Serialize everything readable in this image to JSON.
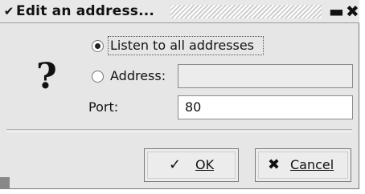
{
  "window": {
    "title": "Edit an address...",
    "menu_icon": "chevron-down-icon",
    "minimize_icon": "minimize-icon",
    "close_icon": "close-icon",
    "menu_glyph": "✔",
    "minimize_glyph": "▬",
    "close_glyph": "✖"
  },
  "dialog": {
    "help_icon": "question-icon",
    "help_glyph": "?",
    "options": [
      {
        "label": "Listen to all addresses",
        "checked": true
      },
      {
        "label": "Address:",
        "checked": false
      }
    ],
    "address": {
      "value": ""
    },
    "port": {
      "label": "Port:",
      "value": "80"
    }
  },
  "buttons": {
    "ok": {
      "label": "OK",
      "icon": "check-icon",
      "glyph": "✓"
    },
    "cancel": {
      "label": "Cancel",
      "icon": "cancel-icon",
      "glyph": "✖"
    }
  }
}
